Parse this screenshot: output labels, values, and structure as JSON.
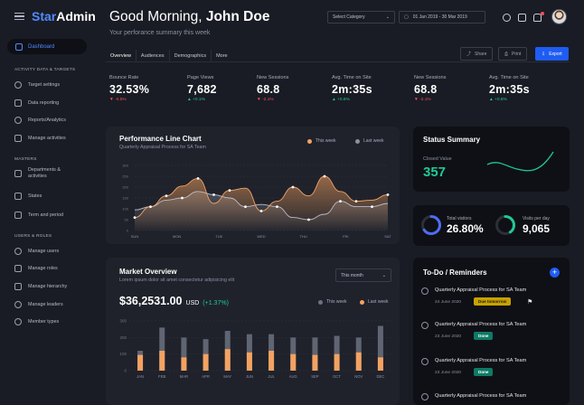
{
  "app": {
    "brand_a": "Star",
    "brand_b": "Admin"
  },
  "sidebar": {
    "active": "Dashboard",
    "section1": "ACTIVITY DATA & TARGETS",
    "items1": [
      "Target settings",
      "Data reporting",
      "Reports/Analytics",
      "Manage activities"
    ],
    "section2": "MASTERS",
    "items2": [
      "Departments &",
      "States",
      "Term and period"
    ],
    "items2_line2": "activities",
    "section3": "USERS & ROLES",
    "items3": [
      "Manage users",
      "Manage roles",
      "Manage hierarchy",
      "Manage leaders",
      "Member types"
    ]
  },
  "header": {
    "greeting": "Good Morning,",
    "name": "John Doe",
    "subtitle": "Your perforance summary this week",
    "category": "Select Category",
    "date_range": "01 Jan 2019 - 30 Mar 2019"
  },
  "tabs": [
    "Overview",
    "Audiences",
    "Demographics",
    "More"
  ],
  "actions": {
    "share": "Share",
    "print": "Print",
    "export": "Export"
  },
  "stats": [
    {
      "label": "Bounce Rate",
      "value": "32.53%",
      "delta": "-0.5%",
      "dir": "down"
    },
    {
      "label": "Page Views",
      "value": "7,682",
      "delta": "+0.1%",
      "dir": "up"
    },
    {
      "label": "New Sessions",
      "value": "68.8",
      "delta": "-2.1%",
      "dir": "down"
    },
    {
      "label": "Avg. Time on Site",
      "value": "2m:35s",
      "delta": "+0.8%",
      "dir": "up"
    },
    {
      "label": "New Sessions",
      "value": "68.8",
      "delta": "-2.1%",
      "dir": "down"
    },
    {
      "label": "Avg. Time on Site",
      "value": "2m:35s",
      "delta": "+0.8%",
      "dir": "up"
    }
  ],
  "perf": {
    "title": "Performance Line Chart",
    "subtitle": "Quarterly Appraisal Process for SA Team",
    "legend_this": "This week",
    "legend_last": "Last week"
  },
  "status": {
    "title": "Status Summary",
    "closed_label": "Closed Value",
    "closed_value": "357"
  },
  "visitors": {
    "total_label": "Total visitors",
    "total_value": "26.80%",
    "visits_label": "Visits per day",
    "visits_value": "9,065",
    "total_fraction": 0.65,
    "visits_fraction": 0.4
  },
  "market": {
    "title": "Market Overview",
    "subtitle": "Lorem ipsum dolor sit amet consectetur adipisicing elit",
    "period": "This month",
    "amount": "$36,2531.00",
    "currency": "USD",
    "change": "(+1.37%)",
    "legend_this": "This week",
    "legend_last": "Last week"
  },
  "todo": {
    "title": "To-Do / Reminders",
    "items": [
      {
        "title": "Quarterly Appraisal Process for SA Team",
        "date": "24 June 2020",
        "badge": "Due tomorrow"
      },
      {
        "title": "Quarterly Appraisal Process for SA Team",
        "date": "23 June 2020",
        "badge": "Done"
      },
      {
        "title": "Quarterly Appraisal Process for SA Team",
        "date": "23 June 2020",
        "badge": "Done"
      },
      {
        "title": "Quarterly Appraisal Process for SA Team",
        "date": "",
        "badge": ""
      }
    ]
  },
  "colors": {
    "accent": "#4f8bff",
    "orange": "#f4a261",
    "grey": "#6c7280",
    "green": "#20c997",
    "red": "#ff4d5b"
  },
  "chart_data": [
    {
      "type": "area",
      "title": "Performance Line Chart",
      "categories": [
        "SUN",
        "MON",
        "TUE",
        "WED",
        "THU",
        "FRI",
        "SAT"
      ],
      "ylim": [
        0,
        300
      ],
      "yticks": [
        0,
        50,
        100,
        150,
        200,
        250,
        300
      ],
      "series": [
        {
          "name": "This week",
          "values": [
            60,
            110,
            160,
            205,
            240,
            125,
            185,
            195,
            90,
            135,
            200,
            160,
            250,
            180,
            135,
            140,
            165
          ]
        },
        {
          "name": "Last week",
          "values": [
            95,
            110,
            140,
            150,
            180,
            165,
            150,
            110,
            120,
            110,
            60,
            50,
            75,
            135,
            110,
            110,
            125
          ]
        }
      ]
    },
    {
      "type": "bar",
      "title": "Market Overview",
      "categories": [
        "JAN",
        "FEB",
        "MAR",
        "APR",
        "MAY",
        "JUN",
        "JUL",
        "AUG",
        "SEP",
        "OCT",
        "NOV",
        "DEC"
      ],
      "ylim": [
        0,
        300
      ],
      "yticks": [
        0,
        100,
        200,
        300
      ],
      "series": [
        {
          "name": "This week",
          "values": [
            95,
            120,
            80,
            100,
            130,
            110,
            120,
            100,
            95,
            100,
            110,
            80
          ]
        },
        {
          "name": "Last week",
          "values": [
            120,
            260,
            200,
            190,
            240,
            220,
            220,
            200,
            200,
            210,
            200,
            270
          ]
        }
      ]
    }
  ]
}
